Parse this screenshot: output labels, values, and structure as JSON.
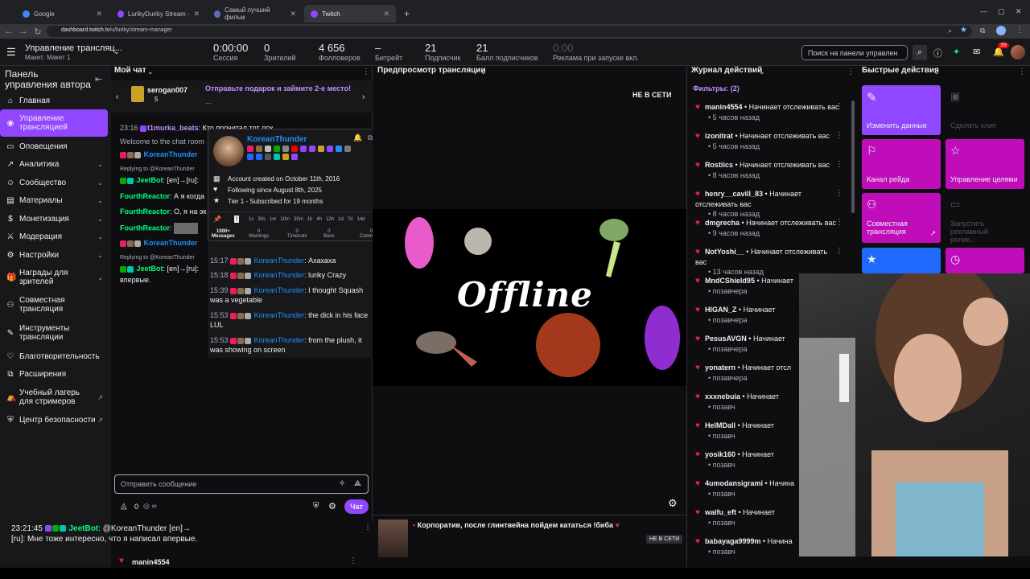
{
  "browser": {
    "tabs": [
      {
        "label": "Google"
      },
      {
        "label": "LurikyDuriky Stream - Watch Li"
      },
      {
        "label": "Самый лучший фильм"
      },
      {
        "label": "Twitch"
      }
    ],
    "url_host": "dashboard.twitch.tv",
    "url_path": "/u/luriky/stream-manager"
  },
  "topbar": {
    "title": "Управление трансляц...",
    "subtitle": "Макет: Макет 1",
    "stats": [
      {
        "value": "0:00:00",
        "label": "Сессия"
      },
      {
        "value": "0",
        "label": "Зрителей"
      },
      {
        "value": "4 656",
        "label": "Фолловеров"
      },
      {
        "value": "–",
        "label": "Битрейт"
      },
      {
        "value": "21",
        "label": "Подписчик"
      },
      {
        "value": "21",
        "label": "Балл подписчиков"
      },
      {
        "value": "0:00",
        "label": "Реклама при запуске вкл."
      }
    ],
    "search_placeholder": "Поиск на панели управлен",
    "notif_count": "39"
  },
  "sidebar": {
    "header": "Панель управления автора",
    "items": [
      {
        "label": "Главная",
        "icon": "home-icon"
      },
      {
        "label": "Управление трансляцией",
        "icon": "broadcast-icon"
      },
      {
        "label": "Оповещения",
        "icon": "alert-icon"
      },
      {
        "label": "Аналитика",
        "icon": "chart-icon"
      },
      {
        "label": "Сообщество",
        "icon": "community-icon"
      },
      {
        "label": "Материалы",
        "icon": "content-icon"
      },
      {
        "label": "Монетизация",
        "icon": "money-icon"
      },
      {
        "label": "Модерация",
        "icon": "sword-icon"
      },
      {
        "label": "Настройки",
        "icon": "gear-icon"
      },
      {
        "label": "Награды для зрителей",
        "icon": "gift-icon"
      },
      {
        "label": "Совместная трансляция",
        "icon": "collab-icon"
      },
      {
        "label": "Инструменты трансляции",
        "icon": "tools-icon"
      },
      {
        "label": "Благотворительность",
        "icon": "charity-icon"
      },
      {
        "label": "Расширения",
        "icon": "extension-icon"
      },
      {
        "label": "Учебный лагерь для стримеров",
        "icon": "camp-icon"
      },
      {
        "label": "Центр безопасности",
        "icon": "shield-icon"
      }
    ]
  },
  "chat": {
    "title": "Мой чат",
    "gift_user": "serogan007",
    "gift_count": "5",
    "gift_text": "Отправьте подарок и займите 2-е место!",
    "gift_more": "...",
    "lines": [
      {
        "time": "23:16",
        "name": "t1murka_beats",
        "text": ": Кто прочитал тот лох"
      },
      {
        "time": "",
        "name": "",
        "text": "Welcome to the chat room"
      },
      {
        "time": "",
        "name": "KoreanThunder",
        "text": ""
      },
      {
        "time": "",
        "name": "",
        "text": "Replying to @KoreanThunder"
      },
      {
        "time": "",
        "name": "JeetBot",
        "text": ": [en]→[ru]:"
      },
      {
        "time": "",
        "name": "FourthReactor",
        "text": ": А я когда"
      },
      {
        "time": "",
        "name": "FourthReactor",
        "text": ": О, я на эк"
      },
      {
        "time": "",
        "name": "FourthReactor",
        "text": ":"
      },
      {
        "time": "",
        "name": "KoreanThunder",
        "text": ""
      },
      {
        "time": "",
        "name": "",
        "text": "Replying to @KoreanThunder"
      },
      {
        "time": "",
        "name": "JeetBot",
        "text": ": [en]→[ru]:"
      },
      {
        "time": "",
        "name": "",
        "text": "впервые."
      }
    ],
    "input_placeholder": "Отправить сообщение",
    "points": "0",
    "chat_button": "Чат"
  },
  "user_card": {
    "name": "KoreanThunder",
    "created": "Account created on October 11th, 2016",
    "following": "Following since August 8th, 2025",
    "tier": "Tier 1 - Subscribed for 19 months",
    "durations": [
      "1s",
      "30s",
      "1m",
      "10m",
      "30m",
      "1h",
      "4h",
      "12h",
      "1d",
      "7d",
      "14d"
    ],
    "tabs": [
      {
        "count": "1000+",
        "label": "Messages"
      },
      {
        "count": "0",
        "label": "Warnings"
      },
      {
        "count": "0",
        "label": "Timeouts"
      },
      {
        "count": "0",
        "label": "Bans"
      },
      {
        "count": "0",
        "label": "Comments"
      }
    ],
    "messages": [
      {
        "time": "15:17",
        "name": "KoreanThunder",
        "text": ": Ахахаха"
      },
      {
        "time": "15:18",
        "name": "KoreanThunder",
        "text": ": luriky Crazy"
      },
      {
        "time": "15:39",
        "name": "KoreanThunder",
        "text": ": I thought Squash"
      },
      {
        "time": "",
        "name": "",
        "text": "was a vegetable"
      },
      {
        "time": "15:53",
        "name": "KoreanThunder",
        "text": ": the dick in his face"
      },
      {
        "time": "",
        "name": "",
        "text": "LUL"
      },
      {
        "time": "15:53",
        "name": "KoreanThunder",
        "text": ": from the plush, it"
      },
      {
        "time": "",
        "name": "",
        "text": "was showing on screen"
      }
    ]
  },
  "preview": {
    "title": "Предпросмотр трансляции",
    "status": "НЕ В СЕТИ",
    "offline_text": "Offline",
    "stream_title": "Корпоратив, после глинтвейна пойдем кататься !биба",
    "stream_status": "НЕ В СЕТИ"
  },
  "activity": {
    "title": "Журнал действий",
    "filters": "Фильтры: (2)",
    "items": [
      {
        "name": "manin4554",
        "action": "Начинает отслеживать вас",
        "time": "5 часов назад"
      },
      {
        "name": "izonitrat",
        "action": "Начинает отслеживать вас",
        "time": "5 часов назад"
      },
      {
        "name": "Rostiics",
        "action": "Начинает отслеживать вас",
        "time": "8 часов назад"
      },
      {
        "name": "henry__cavill_83",
        "action": "Начинает отслеживать вас",
        "time": "8 часов назад"
      },
      {
        "name": "dmgrecha",
        "action": "Начинает отслеживать вас",
        "time": "9 часов назад"
      },
      {
        "name": "NotYoshi__",
        "action": "Начинает отслеживать вас",
        "time": "13 часов назад"
      },
      {
        "name": "MndCShield95",
        "action": "Начинает",
        "time": "позавчера"
      },
      {
        "name": "HIGAN_Z",
        "action": "Начинает",
        "time": "позавчера"
      },
      {
        "name": "PesusAVGN",
        "action": "Начинает",
        "time": "позавчера"
      },
      {
        "name": "yonatern",
        "action": "Начинает отсл",
        "time": "позавчера"
      },
      {
        "name": "xxxnebuia",
        "action": "Начинает",
        "time": "позавч"
      },
      {
        "name": "HelMDall",
        "action": "Начинает",
        "time": "позавч"
      },
      {
        "name": "yosik160",
        "action": "Начинает",
        "time": "позавч"
      },
      {
        "name": "4umodansigrami",
        "action": "Начина",
        "time": "позавч"
      },
      {
        "name": "waifu_eft",
        "action": "Начинает",
        "time": "позавч"
      },
      {
        "name": "babayaga9999m",
        "action": "Начина",
        "time": "позавч"
      }
    ]
  },
  "quick": {
    "title": "Быстрые действия",
    "tiles": [
      {
        "label": "Изменить данные",
        "icon": "pencil-icon",
        "color": "#9147ff",
        "enabled": true
      },
      {
        "label": "Сделать клип",
        "icon": "clip-icon",
        "color": "#0e0e10",
        "enabled": false
      },
      {
        "label": "Канал рейда",
        "icon": "raid-icon",
        "color": "#bf0dba",
        "enabled": true
      },
      {
        "label": "Управление целями",
        "icon": "star-icon",
        "color": "#bf0dba",
        "enabled": true
      },
      {
        "label": "Совместная трансляция",
        "icon": "collab-icon",
        "color": "#bf0dba",
        "enabled": true
      },
      {
        "label": "Запустить рекламный ролик...",
        "icon": "ad-icon",
        "color": "#0e0e10",
        "enabled": false
      },
      {
        "label": "",
        "icon": "star-icon",
        "color": "#1f69ff",
        "enabled": true
      },
      {
        "label": "",
        "icon": "clock-icon",
        "color": "#bf0dba",
        "enabled": true
      }
    ]
  },
  "overlay": {
    "time": "23:21:45",
    "name": "JeetBot",
    "text1": ": @KoreanThunder [en]→",
    "text2": "[ru]: Мне тоже интересно, что я написал впервые.",
    "bottom_label": "Журнал действий",
    "bottom_name": "manin4554"
  },
  "colors": {
    "accent": "#9147ff",
    "pink": "#bf0dba",
    "name_blue": "#1e90ff",
    "name_green": "#00ff7f"
  }
}
